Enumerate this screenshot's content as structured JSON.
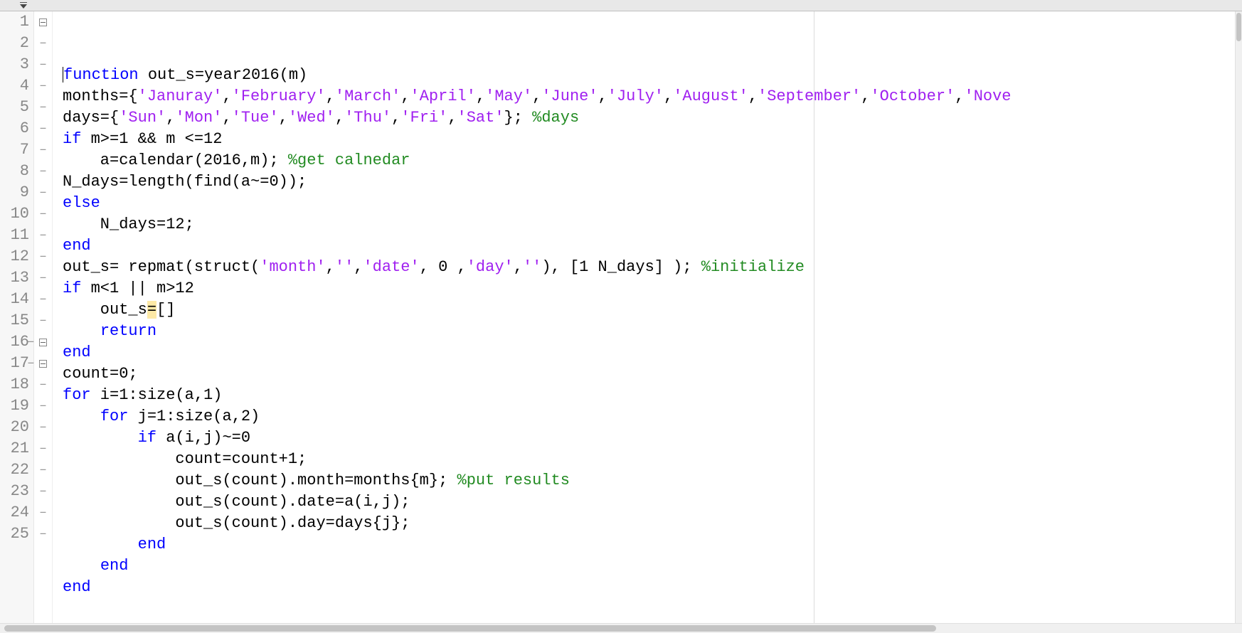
{
  "lines": [
    {
      "n": 1,
      "dash": false,
      "fold": true,
      "tokens": [
        [
          "kw",
          "function"
        ],
        [
          "txt",
          " out_s=year2016(m)"
        ]
      ]
    },
    {
      "n": 2,
      "dash": true,
      "fold": false,
      "tokens": [
        [
          "txt",
          "months={"
        ],
        [
          "str",
          "'Januray'"
        ],
        [
          "txt",
          ","
        ],
        [
          "str",
          "'February'"
        ],
        [
          "txt",
          ","
        ],
        [
          "str",
          "'March'"
        ],
        [
          "txt",
          ","
        ],
        [
          "str",
          "'April'"
        ],
        [
          "txt",
          ","
        ],
        [
          "str",
          "'May'"
        ],
        [
          "txt",
          ","
        ],
        [
          "str",
          "'June'"
        ],
        [
          "txt",
          ","
        ],
        [
          "str",
          "'July'"
        ],
        [
          "txt",
          ","
        ],
        [
          "str",
          "'August'"
        ],
        [
          "txt",
          ","
        ],
        [
          "str",
          "'September'"
        ],
        [
          "txt",
          ","
        ],
        [
          "str",
          "'October'"
        ],
        [
          "txt",
          ","
        ],
        [
          "str",
          "'Nove"
        ]
      ]
    },
    {
      "n": 3,
      "dash": true,
      "fold": false,
      "tokens": [
        [
          "txt",
          "days={"
        ],
        [
          "str",
          "'Sun'"
        ],
        [
          "txt",
          ","
        ],
        [
          "str",
          "'Mon'"
        ],
        [
          "txt",
          ","
        ],
        [
          "str",
          "'Tue'"
        ],
        [
          "txt",
          ","
        ],
        [
          "str",
          "'Wed'"
        ],
        [
          "txt",
          ","
        ],
        [
          "str",
          "'Thu'"
        ],
        [
          "txt",
          ","
        ],
        [
          "str",
          "'Fri'"
        ],
        [
          "txt",
          ","
        ],
        [
          "str",
          "'Sat'"
        ],
        [
          "txt",
          "}; "
        ],
        [
          "com",
          "%days"
        ]
      ]
    },
    {
      "n": 4,
      "dash": true,
      "fold": false,
      "tokens": [
        [
          "kw",
          "if"
        ],
        [
          "txt",
          " m>=1 && m <=12"
        ]
      ]
    },
    {
      "n": 5,
      "dash": true,
      "fold": false,
      "tokens": [
        [
          "txt",
          "    a=calendar(2016,m); "
        ],
        [
          "com",
          "%get calnedar"
        ]
      ]
    },
    {
      "n": 6,
      "dash": true,
      "fold": false,
      "tokens": [
        [
          "txt",
          "N_days=length(find(a~=0));"
        ]
      ]
    },
    {
      "n": 7,
      "dash": true,
      "fold": false,
      "tokens": [
        [
          "kw",
          "else"
        ]
      ]
    },
    {
      "n": 8,
      "dash": true,
      "fold": false,
      "tokens": [
        [
          "txt",
          "    N_days=12;"
        ]
      ]
    },
    {
      "n": 9,
      "dash": true,
      "fold": false,
      "tokens": [
        [
          "kw",
          "end"
        ]
      ]
    },
    {
      "n": 10,
      "dash": true,
      "fold": false,
      "tokens": [
        [
          "txt",
          "out_s= repmat(struct("
        ],
        [
          "str",
          "'month'"
        ],
        [
          "txt",
          ","
        ],
        [
          "str",
          "''"
        ],
        [
          "txt",
          ","
        ],
        [
          "str",
          "'date'"
        ],
        [
          "txt",
          ", 0 ,"
        ],
        [
          "str",
          "'day'"
        ],
        [
          "txt",
          ","
        ],
        [
          "str",
          "''"
        ],
        [
          "txt",
          "), [1 N_days] ); "
        ],
        [
          "com",
          "%initialize"
        ]
      ]
    },
    {
      "n": 11,
      "dash": true,
      "fold": false,
      "tokens": [
        [
          "kw",
          "if"
        ],
        [
          "txt",
          " m<1 || m>12"
        ]
      ]
    },
    {
      "n": 12,
      "dash": true,
      "fold": false,
      "tokens": [
        [
          "txt",
          "    out_s"
        ],
        [
          "mark",
          "="
        ],
        [
          "txt",
          "[]"
        ]
      ]
    },
    {
      "n": 13,
      "dash": true,
      "fold": false,
      "tokens": [
        [
          "txt",
          "    "
        ],
        [
          "kw",
          "return"
        ]
      ]
    },
    {
      "n": 14,
      "dash": true,
      "fold": false,
      "tokens": [
        [
          "kw",
          "end"
        ]
      ]
    },
    {
      "n": 15,
      "dash": true,
      "fold": false,
      "tokens": [
        [
          "txt",
          "count=0;"
        ]
      ]
    },
    {
      "n": 16,
      "dash": true,
      "fold": true,
      "tokens": [
        [
          "kw",
          "for"
        ],
        [
          "txt",
          " i=1:size(a,1)"
        ]
      ]
    },
    {
      "n": 17,
      "dash": true,
      "fold": true,
      "tokens": [
        [
          "txt",
          "    "
        ],
        [
          "kw",
          "for"
        ],
        [
          "txt",
          " j=1:size(a,2)"
        ]
      ]
    },
    {
      "n": 18,
      "dash": true,
      "fold": false,
      "tokens": [
        [
          "txt",
          "        "
        ],
        [
          "kw",
          "if"
        ],
        [
          "txt",
          " a(i,j)~=0"
        ]
      ]
    },
    {
      "n": 19,
      "dash": true,
      "fold": false,
      "tokens": [
        [
          "txt",
          "            count=count+1;"
        ]
      ]
    },
    {
      "n": 20,
      "dash": true,
      "fold": false,
      "tokens": [
        [
          "txt",
          "            out_s(count).month=months{m}; "
        ],
        [
          "com",
          "%put results"
        ]
      ]
    },
    {
      "n": 21,
      "dash": true,
      "fold": false,
      "tokens": [
        [
          "txt",
          "            out_s(count).date=a(i,j);"
        ]
      ]
    },
    {
      "n": 22,
      "dash": true,
      "fold": false,
      "tokens": [
        [
          "txt",
          "            out_s(count).day=days{j};"
        ]
      ]
    },
    {
      "n": 23,
      "dash": true,
      "fold": false,
      "tokens": [
        [
          "txt",
          "        "
        ],
        [
          "kw",
          "end"
        ]
      ]
    },
    {
      "n": 24,
      "dash": true,
      "fold": false,
      "tokens": [
        [
          "txt",
          "    "
        ],
        [
          "kw",
          "end"
        ]
      ]
    },
    {
      "n": 25,
      "dash": true,
      "fold": false,
      "tokens": [
        [
          "kw",
          "end"
        ]
      ]
    }
  ],
  "page_guide_col": 80
}
